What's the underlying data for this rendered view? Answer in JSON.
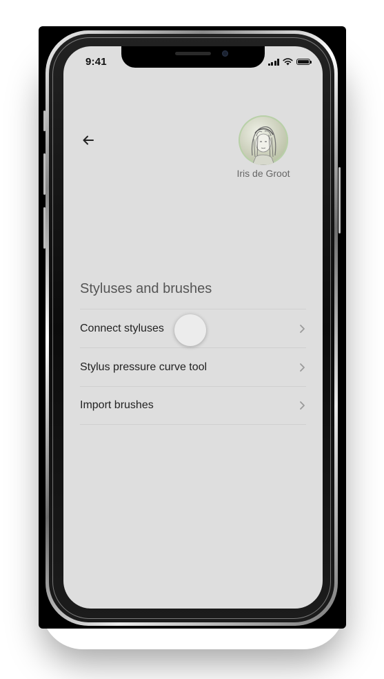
{
  "status_bar": {
    "time": "9:41",
    "icons": [
      "signal-icon",
      "wifi-icon",
      "battery-icon"
    ]
  },
  "header": {
    "back_icon": "arrow-left-icon",
    "profile_name": "Iris de Groot",
    "avatar": "avatar-illustration"
  },
  "section": {
    "title": "Styluses and brushes",
    "items": [
      {
        "label": "Connect styluses",
        "icon": "chevron-right-icon"
      },
      {
        "label": "Stylus pressure curve tool",
        "icon": "chevron-right-icon"
      },
      {
        "label": "Import brushes",
        "icon": "chevron-right-icon"
      }
    ]
  },
  "colors": {
    "screen_bg": "#dedede",
    "text_primary": "#222222",
    "text_secondary": "#666666",
    "divider": "#cfcfcf",
    "chevron": "#9a9a9a"
  }
}
